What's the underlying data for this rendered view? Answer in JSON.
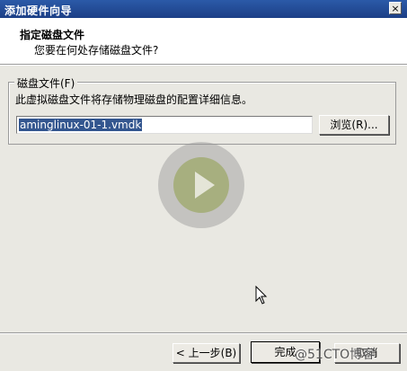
{
  "window": {
    "title": "添加硬件向导",
    "close_label": "×"
  },
  "header": {
    "title": "指定磁盘文件",
    "subtitle": "您要在何处存储磁盘文件?"
  },
  "group": {
    "legend": "磁盘文件(F)",
    "description": "此虚拟磁盘文件将存储物理磁盘的配置详细信息。",
    "file_value": "aminglinux-01-1.vmdk",
    "browse_label": "浏览(R)..."
  },
  "buttons": {
    "back_label": "< 上一步(B)",
    "finish_label": "完成",
    "cancel_label": "取消"
  },
  "overlay": {
    "watermark": "@51CTO博客"
  },
  "icons": {
    "close": "close-icon",
    "play": "play-icon",
    "cursor": "mouse-cursor-icon"
  }
}
